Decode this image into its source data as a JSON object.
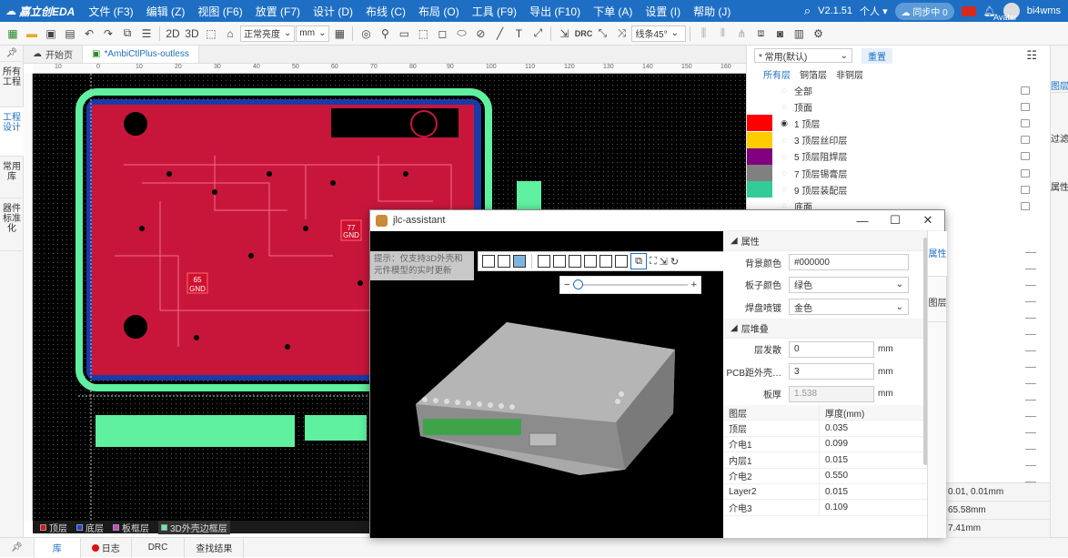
{
  "app": {
    "logo": "嘉立创EDA",
    "version": "V2.1.51",
    "personal": "个人",
    "sync": "同步中 0",
    "user": "bi4wms",
    "avatar_label": "Avatar"
  },
  "menu": [
    "文件 (F3)",
    "编辑 (Z)",
    "视图 (F6)",
    "放置 (F7)",
    "设计 (D)",
    "布线 (C)",
    "布局 (O)",
    "工具 (F9)",
    "导出 (F10)",
    "下单 (A)",
    "设置 (I)",
    "帮助 (J)"
  ],
  "toolbar": {
    "mode2d": "2D",
    "mode3d": "3D",
    "brightness": "正常亮度",
    "unit": "mm",
    "drc": "DRC",
    "line_angle": "线条45°"
  },
  "left_tabs": [
    "所有工程",
    "工程设计",
    "常用库",
    "器件标准化"
  ],
  "tabs": [
    {
      "label": "开始页"
    },
    {
      "label": "*AmbiCtlPlus-outless"
    }
  ],
  "ruler_ticks": [
    "10",
    "0",
    "10",
    "20",
    "30",
    "40",
    "50",
    "60",
    "70",
    "80",
    "90",
    "100",
    "110",
    "120",
    "130",
    "140",
    "150",
    "160"
  ],
  "canvas_labels": {
    "pad1": "65",
    "pad1b": "GND",
    "pad2": "77",
    "pad2b": "GND"
  },
  "layerbar": [
    {
      "label": "顶层",
      "color": "#e01010"
    },
    {
      "label": "底层",
      "color": "#2040e0"
    },
    {
      "label": "板框层",
      "color": "#d040d0"
    },
    {
      "label": "3D外壳边框层",
      "color": "#5ff0a0"
    }
  ],
  "bottom_tabs": [
    "库",
    "日志",
    "DRC",
    "查找结果"
  ],
  "layers_panel": {
    "select": "* 常用(默认)",
    "reset": "重置",
    "filters": [
      "所有层",
      "铜箔层",
      "非铜层"
    ],
    "rows": [
      {
        "label": "全部",
        "color": ""
      },
      {
        "label": "顶面",
        "color": ""
      },
      {
        "label": "1 顶层",
        "color": "#ff0000"
      },
      {
        "label": "3 顶层丝印层",
        "color": "#ffcc00"
      },
      {
        "label": "5 顶层阻焊层",
        "color": "#800080"
      },
      {
        "label": "7 顶层锡膏层",
        "color": "#808080"
      },
      {
        "label": "9 顶层装配层",
        "color": "#33cc99"
      },
      {
        "label": "底面",
        "color": ""
      }
    ]
  },
  "right_tabs": [
    "图层",
    "过滤",
    "属性"
  ],
  "status": [
    "0.01, 0.01mm",
    "65.58mm",
    "7.41mm"
  ],
  "dialog": {
    "title": "jlc-assistant",
    "hint": "提示：仅支持3D外壳和元件模型的实时更新",
    "right_tabs": [
      "属性",
      "图层"
    ],
    "props_title": "属性",
    "bg_label": "背景颜色",
    "bg_value": "#000000",
    "board_label": "板子颜色",
    "board_value": "绿色",
    "pad_label": "焊盘喷镀",
    "pad_value": "金色",
    "stack_title": "层堆叠",
    "spread_label": "层发散",
    "spread_value": "0",
    "dist_label": "PCB距外壳…",
    "dist_value": "3",
    "thick_label": "板厚",
    "thick_value": "1.538",
    "unit": "mm",
    "table_head": [
      "图层",
      "厚度(mm)"
    ],
    "table_rows": [
      [
        "顶层",
        "0.035"
      ],
      [
        "介电1",
        "0.099"
      ],
      [
        "内层1",
        "0.015"
      ],
      [
        "介电2",
        "0.550"
      ],
      [
        "Layer2",
        "0.015"
      ],
      [
        "介电3",
        "0.109"
      ]
    ]
  }
}
